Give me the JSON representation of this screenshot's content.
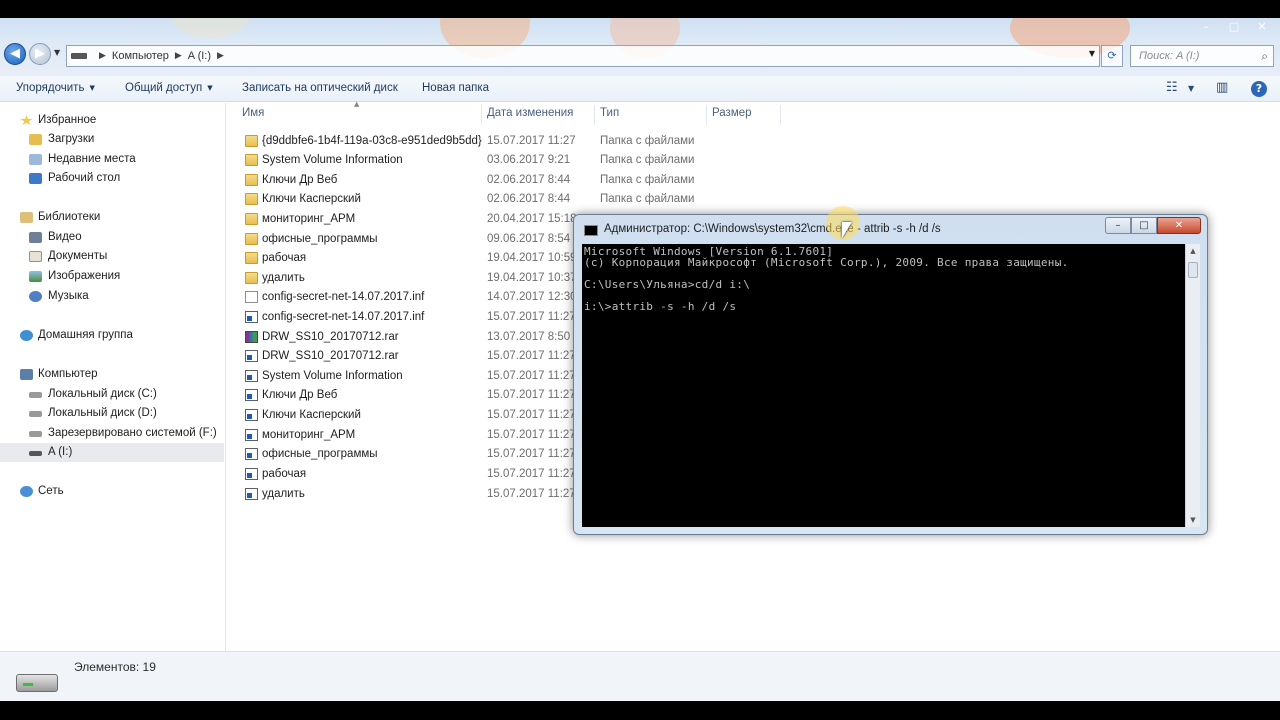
{
  "window": {
    "controls": [
      "–",
      "□",
      "✕"
    ]
  },
  "address_bar": {
    "crumbs": [
      "Компьютер",
      "A (I:)"
    ]
  },
  "search": {
    "placeholder": "Поиск: A (I:)"
  },
  "toolbar": {
    "organize": "Упорядочить",
    "share": "Общий доступ",
    "burn": "Записать на оптический диск",
    "new_folder": "Новая папка"
  },
  "nav": {
    "favorites": "Избранное",
    "downloads": "Загрузки",
    "recent": "Недавние места",
    "desktop": "Рабочий стол",
    "libraries": "Библиотеки",
    "video": "Видео",
    "documents": "Документы",
    "images": "Изображения",
    "music": "Музыка",
    "homegroup": "Домашняя группа",
    "computer": "Компьютер",
    "disk_c": "Локальный диск (C:)",
    "disk_d": "Локальный диск (D:)",
    "disk_f": "Зарезервировано системой (F:)",
    "disk_i": "A (I:)",
    "network": "Сеть"
  },
  "columns": {
    "name": "Имя",
    "date": "Дата изменения",
    "type": "Тип",
    "size": "Размер"
  },
  "files": [
    {
      "name": "{d9ddbfe6-1b4f-119a-03c8-e951ded9b5dd}",
      "date": "15.07.2017 11:27",
      "type": "Папка с файлами"
    },
    {
      "name": "System Volume Information",
      "date": "03.06.2017 9:21",
      "type": "Папка с файлами"
    },
    {
      "name": "Ключи Др Веб",
      "date": "02.06.2017 8:44",
      "type": "Папка с файлами"
    },
    {
      "name": "Ключи Касперский",
      "date": "02.06.2017 8:44",
      "type": "Папка с файлами"
    },
    {
      "name": "мониторинг_АРМ",
      "date": "20.04.2017 15:18",
      "type": ""
    },
    {
      "name": "офисные_программы",
      "date": "09.06.2017 8:54",
      "type": ""
    },
    {
      "name": "рабочая",
      "date": "19.04.2017 10:59",
      "type": ""
    },
    {
      "name": "удалить",
      "date": "19.04.2017 10:37",
      "type": ""
    },
    {
      "name": "config-secret-net-14.07.2017.inf",
      "date": "14.07.2017 12:30",
      "type": ""
    },
    {
      "name": "config-secret-net-14.07.2017.inf",
      "date": "15.07.2017 11:27",
      "type": ""
    },
    {
      "name": "DRW_SS10_20170712.rar",
      "date": "13.07.2017 8:50",
      "type": ""
    },
    {
      "name": "DRW_SS10_20170712.rar",
      "date": "15.07.2017 11:27",
      "type": ""
    },
    {
      "name": "System Volume Information",
      "date": "15.07.2017 11:27",
      "type": ""
    },
    {
      "name": "Ключи Др Веб",
      "date": "15.07.2017 11:27",
      "type": ""
    },
    {
      "name": "Ключи Касперский",
      "date": "15.07.2017 11:27",
      "type": ""
    },
    {
      "name": "мониторинг_АРМ",
      "date": "15.07.2017 11:27",
      "type": ""
    },
    {
      "name": "офисные_программы",
      "date": "15.07.2017 11:27",
      "type": ""
    },
    {
      "name": "рабочая",
      "date": "15.07.2017 11:27",
      "type": ""
    },
    {
      "name": "удалить",
      "date": "15.07.2017 11:27",
      "type": ""
    }
  ],
  "status": {
    "count": "Элементов: 19"
  },
  "cmd": {
    "title": "Администратор: C:\\Windows\\system32\\cmd.exe - attrib  -s -h /d /s",
    "lines": [
      "Microsoft Windows [Version 6.1.7601]",
      "(c) Корпорация Майкрософт (Microsoft Corp.), 2009. Все права защищены.",
      "",
      "C:\\Users\\Ульяна>cd/d i:\\",
      "",
      "i:\\>attrib -s -h /d /s"
    ]
  }
}
